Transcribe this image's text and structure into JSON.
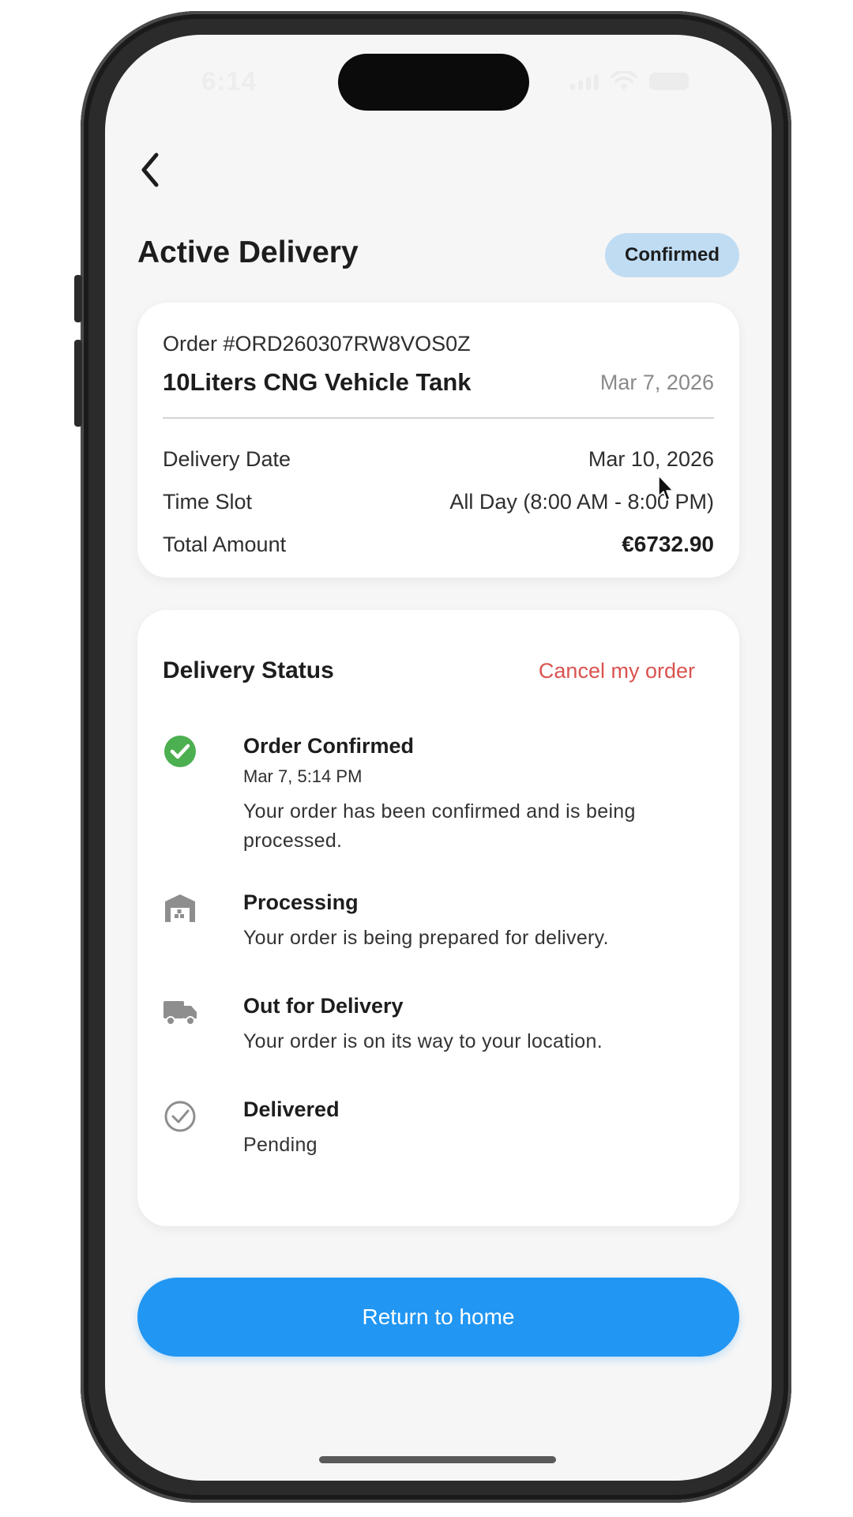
{
  "status_bar": {
    "time": "6:14"
  },
  "header": {
    "title": "Active Delivery",
    "status_badge": "Confirmed",
    "back_icon": "chevron-left-icon"
  },
  "order": {
    "number": "Order #ORD260307RW8VOS0Z",
    "product": "10Liters CNG Vehicle Tank",
    "order_date": "Mar 7, 2026",
    "rows": [
      {
        "label": "Delivery Date",
        "value": "Mar 10, 2026"
      },
      {
        "label": "Time Slot",
        "value": "All Day (8:00 AM - 8:00 PM)"
      },
      {
        "label": "Total Amount",
        "value": "€6732.90"
      }
    ]
  },
  "delivery_status": {
    "title": "Delivery Status",
    "cancel_label": "Cancel my order",
    "steps": [
      {
        "title": "Order Confirmed",
        "time": "Mar 7, 5:14 PM",
        "description": "Your order has been confirmed and is being processed.",
        "icon": "check-circle-icon",
        "state": "done"
      },
      {
        "title": "Processing",
        "description": "Your order is being prepared for delivery.",
        "icon": "warehouse-icon",
        "state": "pending"
      },
      {
        "title": "Out for Delivery",
        "description": "Your order is on its way to your location.",
        "icon": "truck-icon",
        "state": "pending"
      },
      {
        "title": "Delivered",
        "description": "Pending",
        "icon": "check-outline-icon",
        "state": "pending"
      }
    ]
  },
  "cta": {
    "label": "Return to home"
  },
  "colors": {
    "accent": "#2196f3",
    "badge_bg": "#bfdcf3",
    "success": "#4caf50",
    "cancel": "#d9534f",
    "muted_icon": "#8e8e8e"
  }
}
